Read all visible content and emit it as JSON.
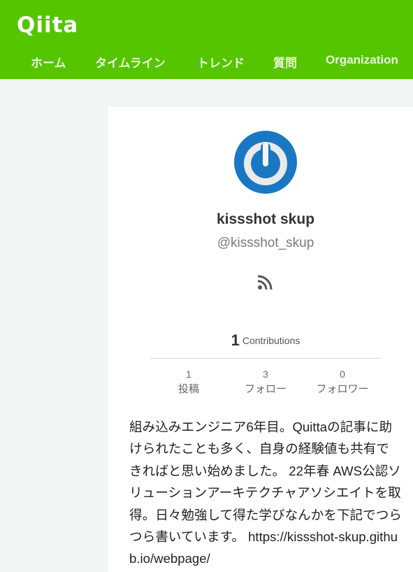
{
  "header": {
    "logo": "Qiita",
    "nav": [
      "ホーム",
      "タイムライン",
      "トレンド",
      "質問",
      "Organization"
    ]
  },
  "profile": {
    "name": "kissshot skup",
    "handle": "@kissshot_skup",
    "contributions_count": "1",
    "contributions_label": "Contributions",
    "stats": [
      {
        "value": "1",
        "label": "投稿"
      },
      {
        "value": "3",
        "label": "フォロー"
      },
      {
        "value": "0",
        "label": "フォロワー"
      }
    ],
    "bio": "組み込みエンジニア6年目。Quittaの記事に助けられたことも多く、自身の経験値も共有できればと思い始めました。 22年春 AWS公認ソリューションアーキテクチャアソシエイトを取得。日々勉強して得た学びなんかを下記でつらつら書いています。 https://kissshot-skup.github.io/webpage/"
  },
  "colors": {
    "brand": "#55c500",
    "avatar_blue": "#1a78c2"
  },
  "icons": [
    "rss-icon",
    "avatar-power-icon"
  ]
}
